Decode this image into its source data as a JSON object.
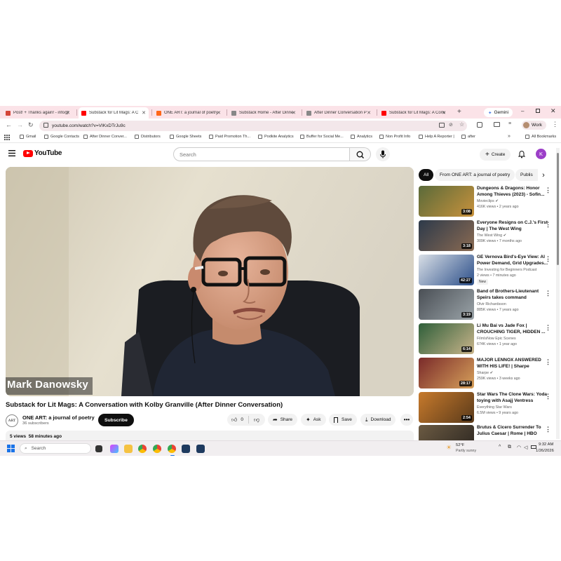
{
  "browser": {
    "tabs": [
      {
        "title": "Post! + Thanks again! - info@",
        "fav": "#d44638"
      },
      {
        "title": "Substack for Lit Mags: A C",
        "fav": "#ff0000",
        "active": true
      },
      {
        "title": "ONE ART: a journal of poetry",
        "fav": "#ff6719"
      },
      {
        "title": "Substack Home - After Dinne",
        "fav": "#888888"
      },
      {
        "title": "After Dinner Conversation P",
        "fav": "#888888"
      },
      {
        "title": "Substack for Lit Mags: A Conv",
        "fav": "#ff0000"
      }
    ],
    "gemini_label": "Gemini",
    "url": "youtube.com/watch?v=VIKxDTrJu9c",
    "profile_label": "Work",
    "bookmarks": [
      "Gmail",
      "Google Contacts",
      "After Dinner Conver...",
      "Distributors",
      "Google Sheets",
      "Paid Promotion Th...",
      "Podkite Analytics",
      "Buffer for Social Me...",
      "Analytics",
      "Non Profit Info",
      "Help A Reporter |",
      "after"
    ],
    "all_bookmarks": "All Bookmarks"
  },
  "youtube": {
    "logo_text": "YouTube",
    "search_placeholder": "Search",
    "create_label": "Create",
    "avatar_letter": "K",
    "video": {
      "overlay_name": "Mark Danowsky",
      "title": "Substack for Lit Mags: A Conversation with Kolby Granville (After Dinner Conversation)",
      "channel": "ONE ART: a journal of poetry",
      "channel_avatar": "ART",
      "subscribers": "36 subscribers",
      "subscribe_label": "Subscribe",
      "likes": "0",
      "share_label": "Share",
      "ask_label": "Ask",
      "save_label": "Save",
      "download_label": "Download",
      "views": "5 views",
      "age": "58 minutes ago"
    },
    "filter_chips": [
      "All",
      "From ONE ART: a journal of poetry",
      "Publis"
    ],
    "recommendations": [
      {
        "title": "Dungeons & Dragons: Honor Among Thieves (2023) - Sofin...",
        "channel": "Movieclips",
        "verified": true,
        "meta": "416K views • 2 years ago",
        "duration": "3:08",
        "c1": "#5a6a3a",
        "c2": "#c8923c"
      },
      {
        "title": "Everyone Resigns on C.J.'s First Day | The West Wing",
        "channel": "The West Wing",
        "verified": true,
        "meta": "309K views • 7 months ago",
        "duration": "3:18",
        "c1": "#2d3a4a",
        "c2": "#8a6a52"
      },
      {
        "title": "GE Vernova Bird's-Eye View: AI Power Demand, Grid Upgrades...",
        "channel": "The Investing for Beginners Podcast",
        "verified": false,
        "meta": "2 views • 7 minutes ago",
        "duration": "42:27",
        "badge": "New",
        "c1": "#d9dfe6",
        "c2": "#2c4f8a"
      },
      {
        "title": "Band of Brothers-Lieutenant Speirs takes command",
        "channel": "Olvir Richardsson",
        "verified": false,
        "meta": "885K views • 7 years ago",
        "duration": "3:19",
        "c1": "#4a4f55",
        "c2": "#9aa3a8"
      },
      {
        "title": "Li Mu Bai vs Jade Fox | CROUCHING TIGER, HIDDEN ...",
        "channel": "FilmIsNow Epic Scenes",
        "verified": false,
        "meta": "674K views • 1 year ago",
        "duration": "6:14",
        "c1": "#2f5f3a",
        "c2": "#c9b48a"
      },
      {
        "title": "MAJOR LENNOX ANSWERED WITH HIS LIFE! | Sharpe",
        "channel": "Sharpe",
        "verified": true,
        "meta": "259K views • 3 weeks ago",
        "duration": "28:17",
        "c1": "#7a2a2a",
        "c2": "#d6a05a"
      },
      {
        "title": "Star Wars The Clone Wars: Yoda toying with Asajj Ventress",
        "channel": "Everything Star Wars",
        "verified": false,
        "meta": "6.5M views • 9 years ago",
        "duration": "2:54",
        "c1": "#c77a2c",
        "c2": "#5a3a1a"
      },
      {
        "title": "Brutus & Cicero Surrender To Julius Caesar | Rome | HBO",
        "channel": "",
        "verified": false,
        "meta": "",
        "duration": "",
        "c1": "#6b5a42",
        "c2": "#2a2520"
      }
    ]
  },
  "taskbar": {
    "search_placeholder": "Search",
    "weather_temp": "52°F",
    "weather_desc": "Partly sunny",
    "time": "9:32 AM",
    "date": "1/26/2026"
  }
}
